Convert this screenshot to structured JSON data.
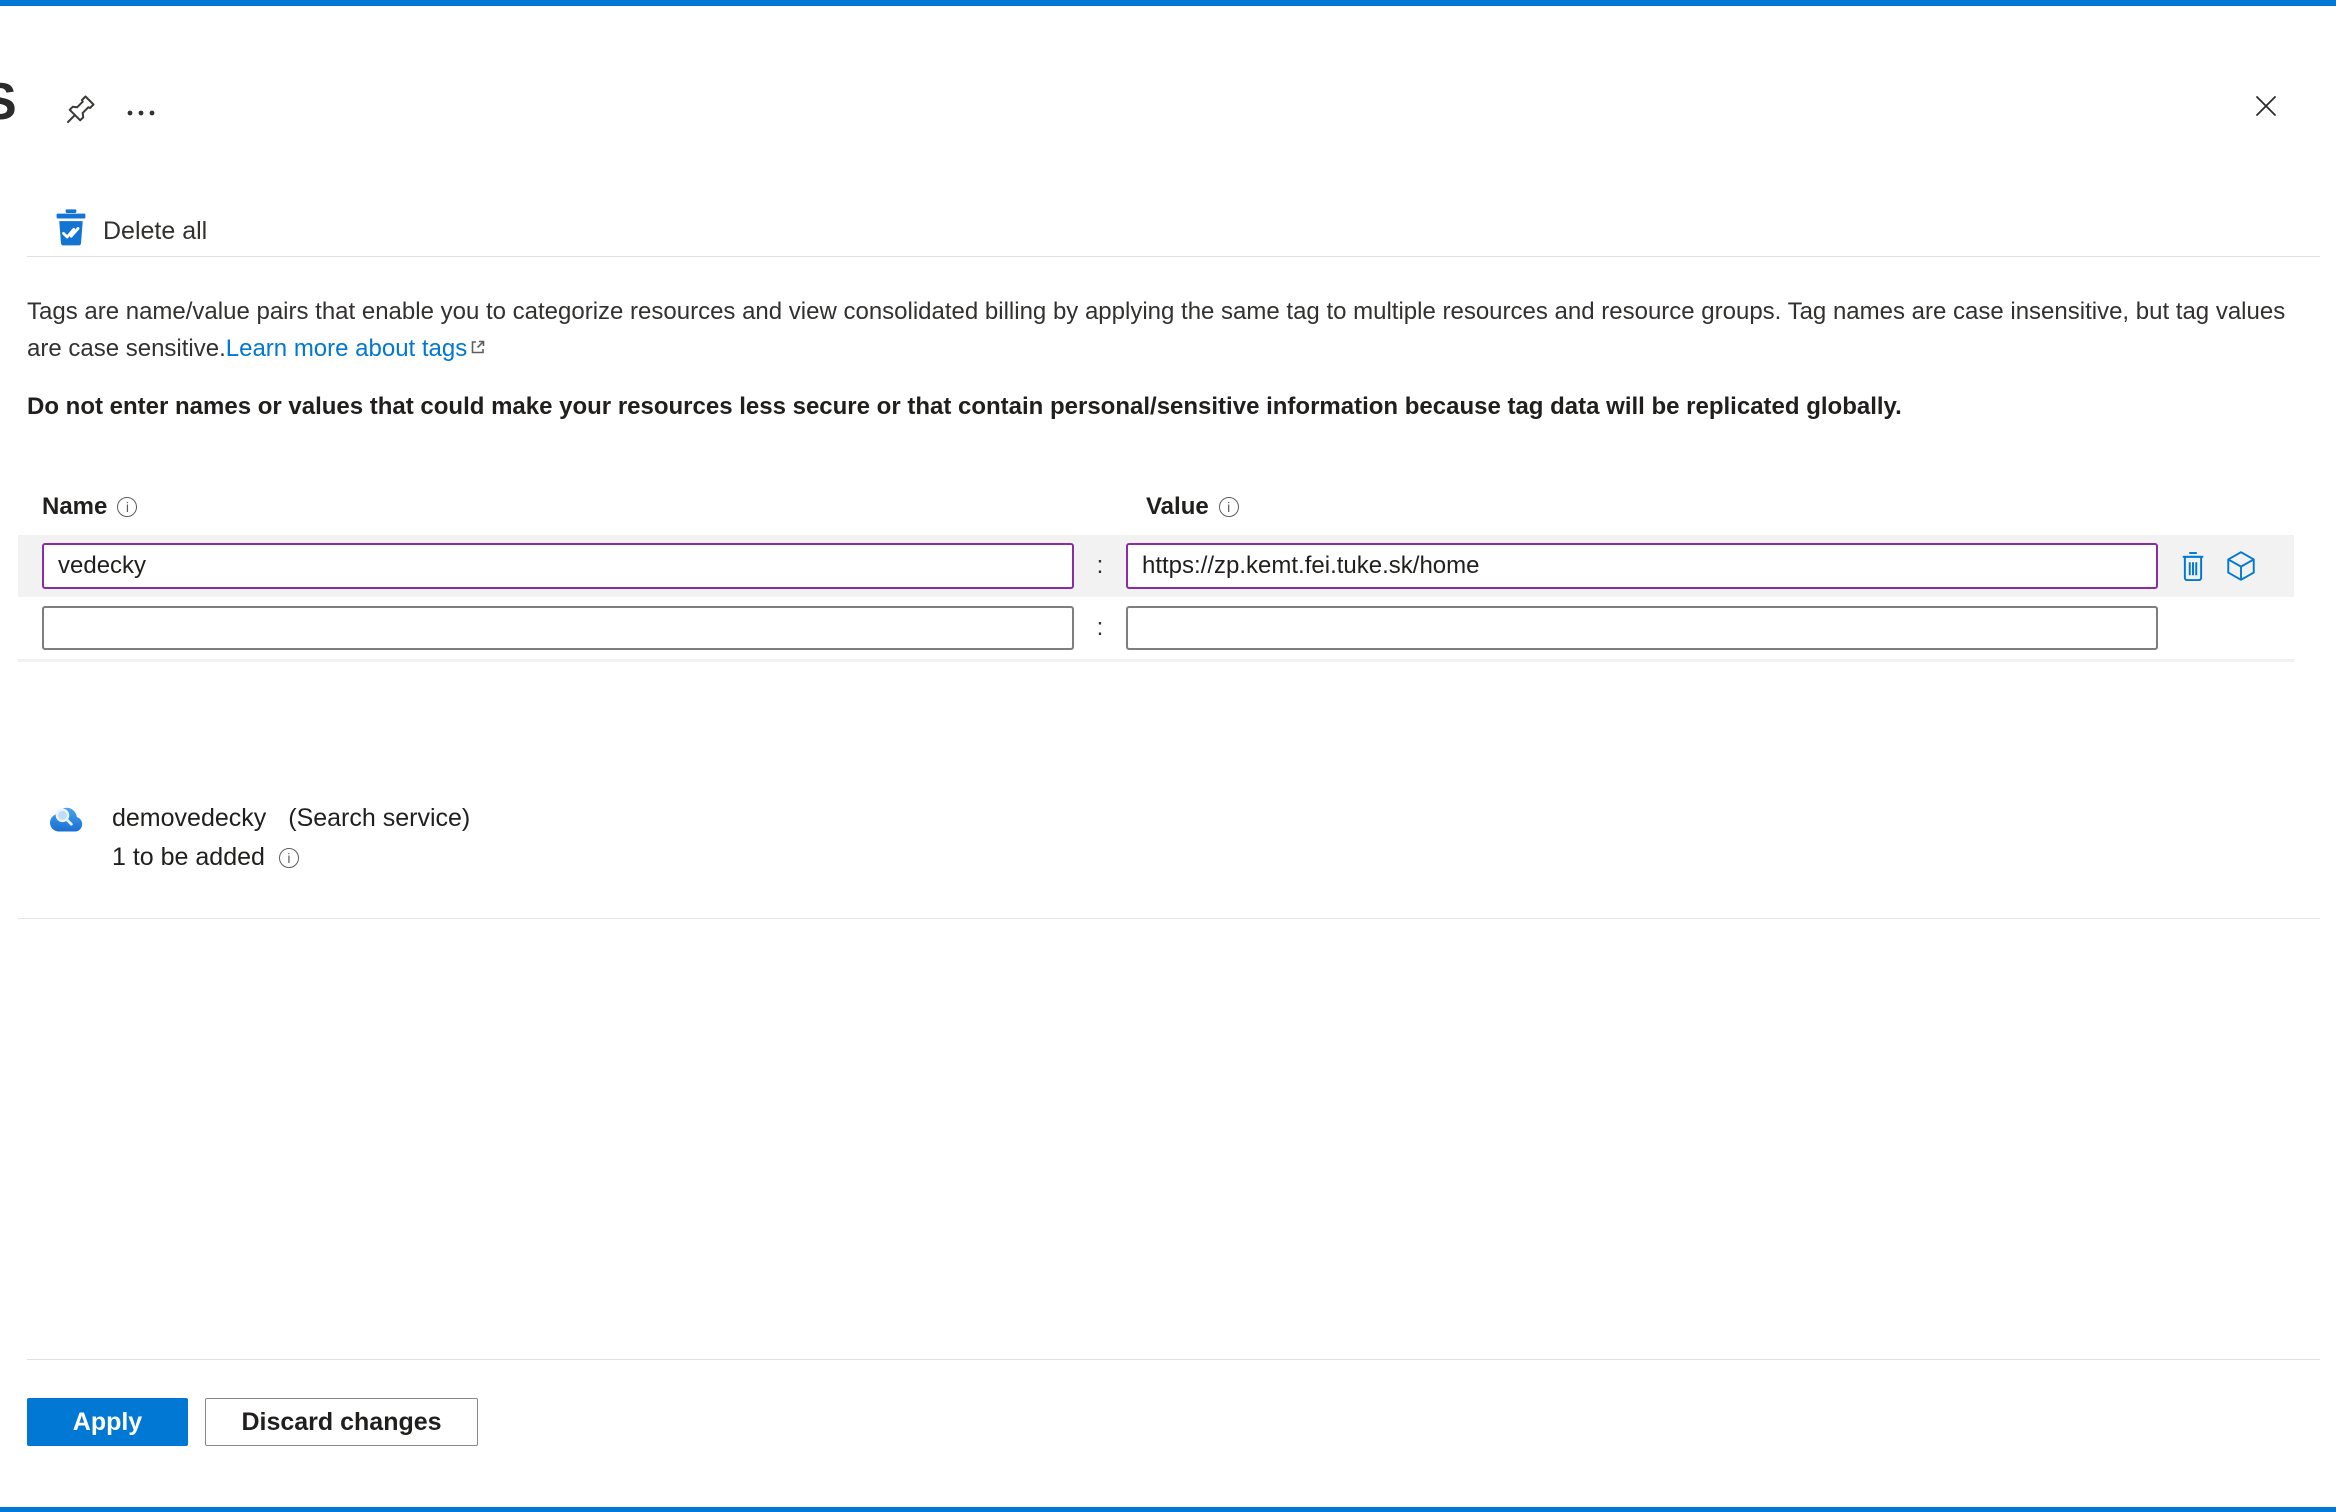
{
  "colors": {
    "accent": "#0078d4",
    "active_input_border": "#8a2da5",
    "row_highlight": "#f2f2f2",
    "link": "#0078d4",
    "text_primary": "#323130"
  },
  "blade": {
    "partial_title": "S"
  },
  "toolbar": {
    "delete_all_label": "Delete all"
  },
  "description": {
    "body": "Tags are name/value pairs that enable you to categorize resources and view consolidated billing by applying the same tag to multiple resources and resource groups. Tag names are case insensitive, but tag values are case sensitive.",
    "link_label": "Learn more about tags",
    "warning": "Do not enter names or values that could make your resources less secure or that contain personal/sensitive information because tag data will be replicated globally."
  },
  "tag_editor": {
    "name_header": "Name",
    "value_header": "Value",
    "separator": ":",
    "rows": [
      {
        "name": "vedecky",
        "value": "https://zp.kemt.fei.tuke.sk/home"
      },
      {
        "name": "",
        "value": ""
      }
    ]
  },
  "resource": {
    "name": "demovedecky",
    "type": "(Search service)",
    "pending": "1 to be added"
  },
  "footer": {
    "apply_label": "Apply",
    "discard_label": "Discard changes"
  },
  "icons": {
    "pin": "pin-icon",
    "more": "more-ellipsis-icon",
    "close": "close-icon",
    "delete_all": "delete-all-checked-trash-icon",
    "info": "info-icon",
    "external_link": "external-link-icon",
    "delete_row": "trash-icon",
    "resource_cube": "cube-icon",
    "search_service": "cloud-search-icon"
  }
}
